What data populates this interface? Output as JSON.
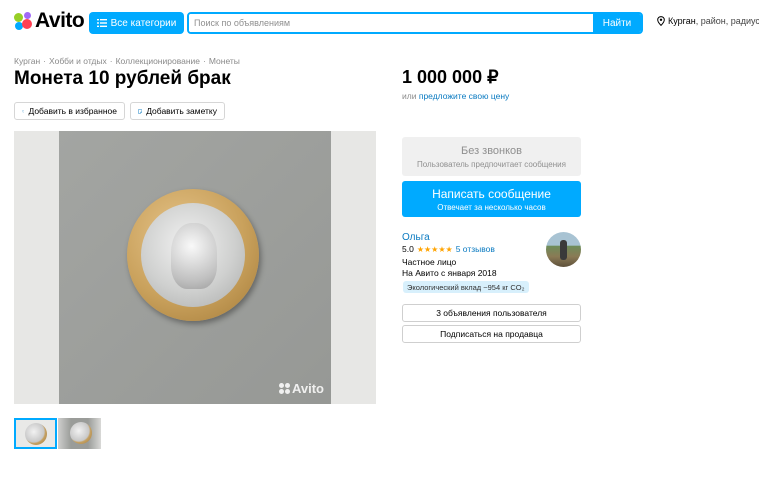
{
  "header": {
    "logo_text": "Avito",
    "categories_label": "Все категории",
    "search": {
      "placeholder": "Поиск по объявлениям",
      "value": ""
    },
    "search_button": "Найти",
    "location": {
      "city": "Курган",
      "suffix": ", район, радиус"
    }
  },
  "breadcrumbs": [
    "Курган",
    "Хобби и отдых",
    "Коллекционирование",
    "Монеты"
  ],
  "listing": {
    "title": "Монета 10 рублей брак",
    "favorite_label": "Добавить в избранное",
    "note_label": "Добавить заметку",
    "price": "1 000 000 ₽",
    "offer_prefix": "или",
    "offer_link": "предложите свою цену",
    "photo_watermark": "Avito",
    "photo_count": 2,
    "selected_photo": 1
  },
  "contact": {
    "no_calls_title": "Без звонков",
    "no_calls_subtitle": "Пользователь предпочитает сообщения",
    "message_title": "Написать сообщение",
    "message_subtitle": "Отвечает за несколько часов"
  },
  "seller": {
    "name": "Ольга",
    "rating": "5.0",
    "stars": "★★★★★",
    "reviews": "5 отзывов",
    "type": "Частное лицо",
    "since": "На Авито с января 2018",
    "eco_badge": "Экологический вклад ~954 кг CO₂",
    "ads_button": "3 объявления пользователя",
    "subscribe_button": "Подписаться на продавца"
  },
  "colors": {
    "accent": "#00aaff",
    "link": "#0a7ac1",
    "star": "#ffa300"
  }
}
